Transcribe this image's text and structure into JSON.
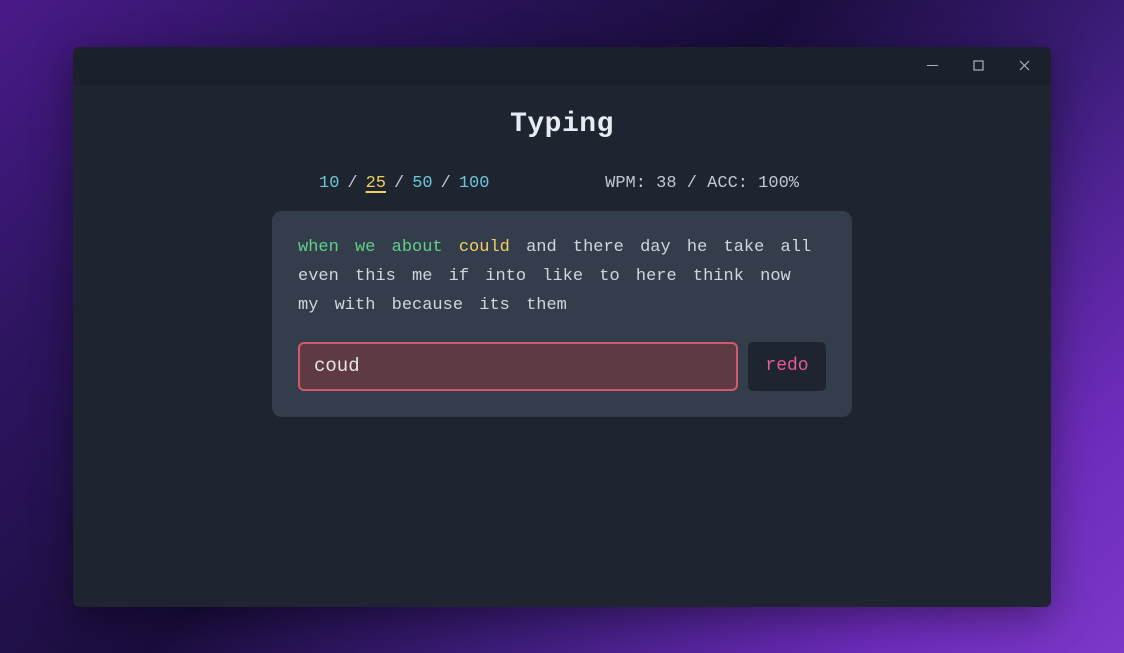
{
  "title": "Typing",
  "word_count_options": [
    "10",
    "25",
    "50",
    "100"
  ],
  "word_count_active_index": 1,
  "stats": {
    "wpm_label": "WPM",
    "wpm_value": "38",
    "acc_label": "ACC",
    "acc_value": "100%"
  },
  "stats_line": "WPM: 38 / ACC: 100%",
  "words": [
    {
      "text": "when",
      "state": "correct"
    },
    {
      "text": "we",
      "state": "correct"
    },
    {
      "text": "about",
      "state": "correct"
    },
    {
      "text": "could",
      "state": "current"
    },
    {
      "text": "and",
      "state": "pending"
    },
    {
      "text": "there",
      "state": "pending"
    },
    {
      "text": "day",
      "state": "pending"
    },
    {
      "text": "he",
      "state": "pending"
    },
    {
      "text": "take",
      "state": "pending"
    },
    {
      "text": "all",
      "state": "pending"
    },
    {
      "text": "even",
      "state": "pending"
    },
    {
      "text": "this",
      "state": "pending"
    },
    {
      "text": "me",
      "state": "pending"
    },
    {
      "text": "if",
      "state": "pending"
    },
    {
      "text": "into",
      "state": "pending"
    },
    {
      "text": "like",
      "state": "pending"
    },
    {
      "text": "to",
      "state": "pending"
    },
    {
      "text": "here",
      "state": "pending"
    },
    {
      "text": "think",
      "state": "pending"
    },
    {
      "text": "now",
      "state": "pending"
    },
    {
      "text": "my",
      "state": "pending"
    },
    {
      "text": "with",
      "state": "pending"
    },
    {
      "text": "because",
      "state": "pending"
    },
    {
      "text": "its",
      "state": "pending"
    },
    {
      "text": "them",
      "state": "pending"
    }
  ],
  "input": {
    "value": "coud",
    "error": true
  },
  "redo_label": "redo",
  "separator": "/"
}
